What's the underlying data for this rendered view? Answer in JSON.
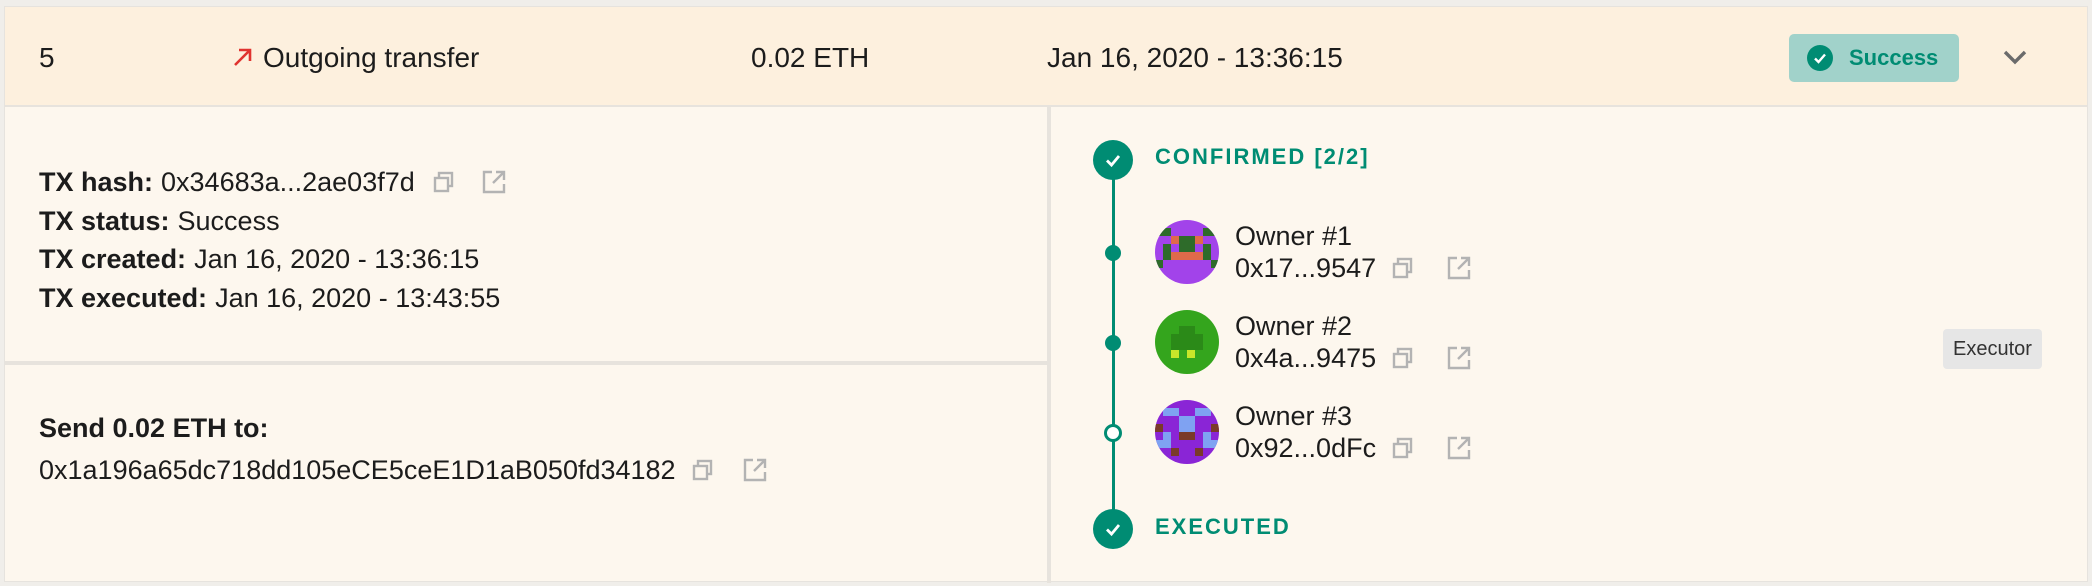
{
  "row": {
    "id": "5",
    "type": "Outgoing transfer",
    "amount": "0.02 ETH",
    "date": "Jan 16, 2020 - 13:36:15",
    "status": "Success"
  },
  "details": {
    "tx_hash_label": "TX hash:",
    "tx_hash_value": "0x34683a...2ae03f7d",
    "tx_status_label": "TX status:",
    "tx_status_value": "Success",
    "tx_created_label": "TX created:",
    "tx_created_value": "Jan 16, 2020 - 13:36:15",
    "tx_executed_label": "TX executed:",
    "tx_executed_value": "Jan 16, 2020 - 13:43:55"
  },
  "send": {
    "title": "Send 0.02 ETH to:",
    "address": "0x1a196a65dc718dd105eCE5ceE1D1aB050fd34182"
  },
  "timeline": {
    "confirmed_label": "CONFIRMED [2/2]",
    "executed_label": "EXECUTED",
    "owners": [
      {
        "name": "Owner #1",
        "address": "0x17...9547"
      },
      {
        "name": "Owner #2",
        "address": "0x4a...9475"
      },
      {
        "name": "Owner #3",
        "address": "0x92...0dFc"
      }
    ],
    "executor_badge": "Executor"
  },
  "colors": {
    "accent": "#008c73",
    "outgoing_arrow": "#e0332f",
    "status_badge_bg": "#a1d2ca",
    "row_highlight": "#fdf0de"
  },
  "icons": [
    "arrow-outgoing-icon",
    "check-circle-icon",
    "chevron-down-icon",
    "copy-icon",
    "external-link-icon"
  ]
}
